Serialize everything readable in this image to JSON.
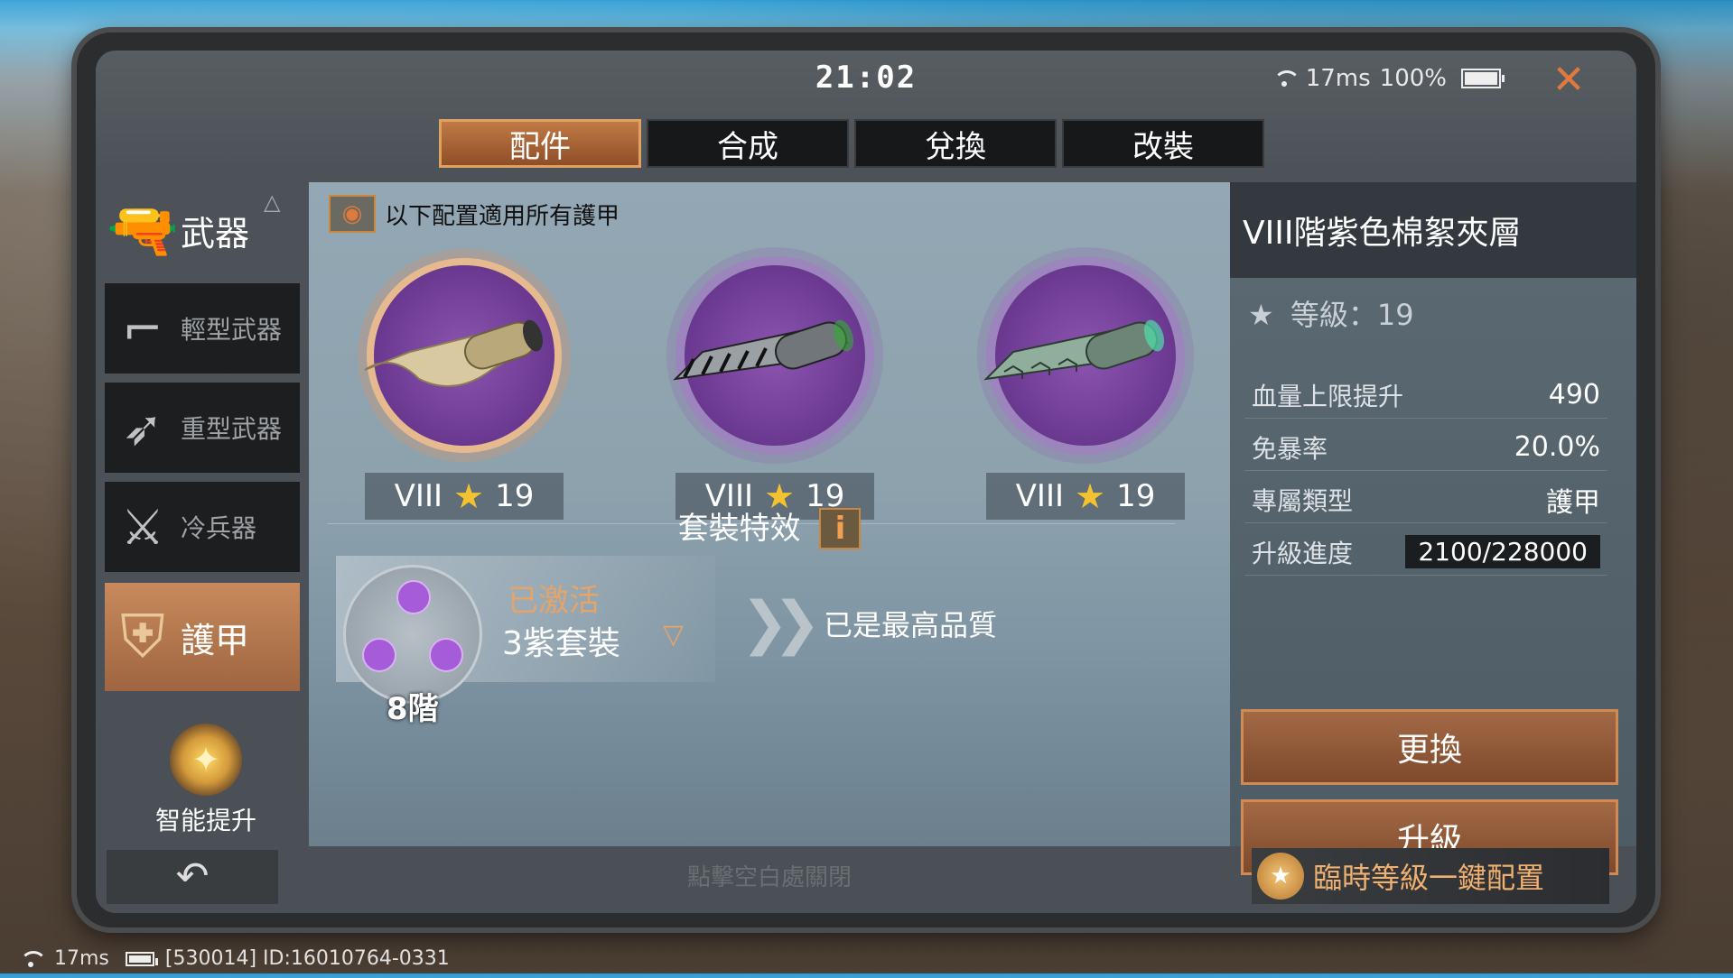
{
  "topbar": {
    "clock": "21:02",
    "ping": "17ms",
    "battery": "100%"
  },
  "tabs": [
    {
      "label": "配件",
      "active": true
    },
    {
      "label": "合成",
      "active": false
    },
    {
      "label": "兌換",
      "active": false
    },
    {
      "label": "改裝",
      "active": false
    }
  ],
  "sidebar": {
    "weapon": "武器",
    "light": "輕型武器",
    "heavy": "重型武器",
    "cold": "冷兵器",
    "armor": "護甲",
    "smart": "智能提升"
  },
  "main": {
    "note": "以下配置適用所有護甲",
    "slots": [
      {
        "tier": "VIII",
        "level": "19",
        "color": "#d8c9a0",
        "selected": true
      },
      {
        "tier": "VIII",
        "level": "19",
        "color": "#9aa0a4",
        "selected": false
      },
      {
        "tier": "VIII",
        "level": "19",
        "color": "#8fae9c",
        "selected": false
      }
    ],
    "suit_title": "套裝特效",
    "suit_info": "i",
    "suit_active": "已激活",
    "suit_name": "3紫套裝",
    "suit_grade": "8階",
    "max_quality": "已是最高品質"
  },
  "panel": {
    "title": "VIII階紫色棉絮夾層",
    "rank_label": "等級：19",
    "stats": [
      {
        "label": "血量上限提升",
        "value": "490"
      },
      {
        "label": "免暴率",
        "value": "20.0%"
      },
      {
        "label": "專屬類型",
        "value": "護甲"
      },
      {
        "label": "升級進度",
        "value": "2100/228000"
      }
    ],
    "replace": "更換",
    "upgrade": "升級"
  },
  "footer": {
    "hint": "點擊空白處關閉",
    "config": "臨時等級一鍵配置"
  },
  "bottom_status": {
    "ping": "17ms",
    "id": "[530014] ID:16010764-0331"
  },
  "colors": {
    "accent": "#e07a3c",
    "purple": "#7b3fa6",
    "star": "#f2c230"
  }
}
